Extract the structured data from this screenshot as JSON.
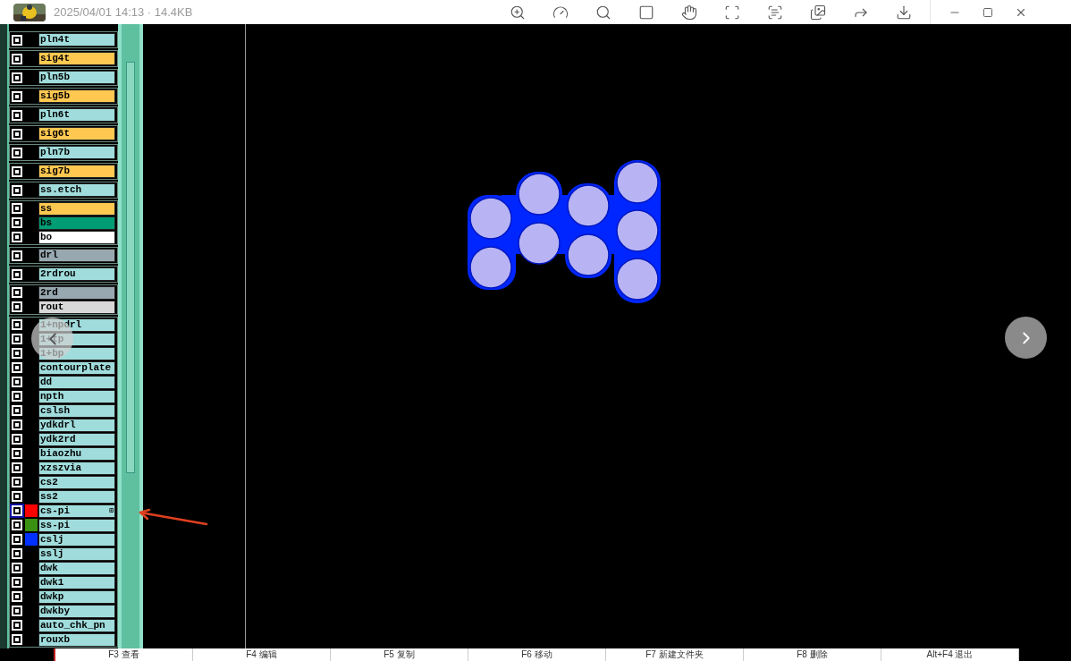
{
  "header": {
    "info": "2025/04/01 14:13 · 14.4KB"
  },
  "layers": {
    "groups": [
      {
        "items": [
          {
            "name": "pln4t",
            "kind": "plane",
            "selected": false
          }
        ]
      },
      {
        "items": [
          {
            "name": "sig4t",
            "kind": "signal",
            "selected": false
          }
        ]
      },
      {
        "items": [
          {
            "name": "pln5b",
            "kind": "plane",
            "selected": false
          }
        ]
      },
      {
        "items": [
          {
            "name": "sig5b",
            "kind": "signal",
            "selected": false
          }
        ]
      },
      {
        "items": [
          {
            "name": "pln6t",
            "kind": "plane",
            "selected": false
          }
        ]
      },
      {
        "items": [
          {
            "name": "sig6t",
            "kind": "signal",
            "selected": false
          }
        ]
      },
      {
        "items": [
          {
            "name": "pln7b",
            "kind": "plane",
            "selected": false
          }
        ]
      },
      {
        "items": [
          {
            "name": "sig7b",
            "kind": "signal",
            "selected": false
          }
        ]
      },
      {
        "items": [
          {
            "name": "ss.etch",
            "kind": "plane",
            "selected": false
          }
        ]
      },
      {
        "items": [
          {
            "name": "ss",
            "kind": "signal",
            "selected": false
          },
          {
            "name": "bs",
            "kind": "mask",
            "selected": false
          },
          {
            "name": "bo",
            "kind": "outline",
            "selected": false
          }
        ]
      },
      {
        "items": [
          {
            "name": "drl",
            "kind": "drill",
            "selected": false
          }
        ]
      },
      {
        "items": [
          {
            "name": "2rdrou",
            "kind": "plane",
            "selected": false
          }
        ]
      },
      {
        "items": [
          {
            "name": "2rd",
            "kind": "drill",
            "selected": false
          },
          {
            "name": "rout",
            "kind": "route",
            "selected": false
          }
        ]
      },
      {
        "items": [
          {
            "name": "1+npdrl",
            "kind": "plane",
            "selected": false
          },
          {
            "name": "1+tp",
            "kind": "plane",
            "selected": false
          },
          {
            "name": "1+bp",
            "kind": "plane",
            "selected": false
          },
          {
            "name": "contourplate",
            "kind": "plane",
            "selected": false
          },
          {
            "name": "dd",
            "kind": "plane",
            "selected": false
          },
          {
            "name": "npth",
            "kind": "plane",
            "selected": false
          },
          {
            "name": "cslsh",
            "kind": "plane",
            "selected": false
          },
          {
            "name": "ydkdrl",
            "kind": "plane",
            "selected": false
          },
          {
            "name": "ydk2rd",
            "kind": "plane",
            "selected": false
          },
          {
            "name": "biaozhu",
            "kind": "plane",
            "selected": false
          },
          {
            "name": "xzszvia",
            "kind": "plane",
            "selected": false
          },
          {
            "name": "cs2",
            "kind": "plane",
            "selected": false
          },
          {
            "name": "ss2",
            "kind": "plane",
            "selected": false
          },
          {
            "name": "cs-pi",
            "kind": "plane",
            "selected": true,
            "color": "#ff0000",
            "mark": "⊞"
          },
          {
            "name": "ss-pi",
            "kind": "plane",
            "selected": false,
            "color": "#3a9010"
          },
          {
            "name": "cslj",
            "kind": "plane",
            "selected": false,
            "color": "#0030ff"
          },
          {
            "name": "sslj",
            "kind": "plane",
            "selected": false
          },
          {
            "name": "dwk",
            "kind": "plane",
            "selected": false
          },
          {
            "name": "dwk1",
            "kind": "plane",
            "selected": false
          },
          {
            "name": "dwkp",
            "kind": "plane",
            "selected": false
          },
          {
            "name": "dwkby",
            "kind": "plane",
            "selected": false
          },
          {
            "name": "auto_chk_pn",
            "kind": "plane",
            "selected": false
          },
          {
            "name": "rouxb",
            "kind": "plane",
            "selected": false
          }
        ]
      }
    ]
  },
  "function_keys": [
    "F3 查看",
    "F4 编辑",
    "F5 复制",
    "F6 移动",
    "F7 新建文件夹",
    "F8 删除",
    "Alt+F4 退出"
  ]
}
